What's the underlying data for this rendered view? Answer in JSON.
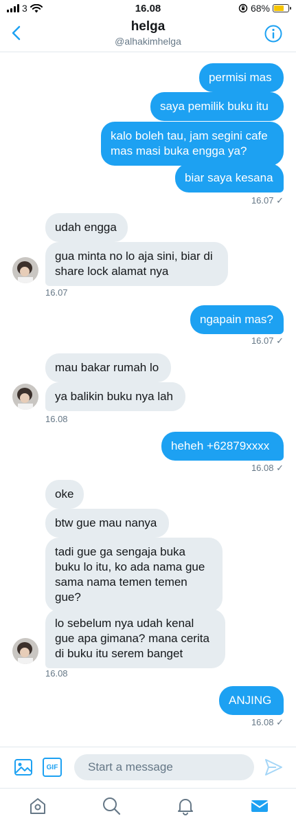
{
  "status_bar": {
    "carrier": "3",
    "time": "16.08",
    "battery": "68%",
    "battery_level": 0.68
  },
  "header": {
    "title": "helga",
    "handle": "@alhakimhelga"
  },
  "colors": {
    "accent": "#1da1f2",
    "incoming_bubble": "#e6ecf0",
    "meta_text": "#657786"
  },
  "messages": [
    {
      "dir": "out",
      "text": "permisi mas"
    },
    {
      "dir": "out",
      "text": "saya pemilik buku itu"
    },
    {
      "dir": "out",
      "text": "kalo boleh tau, jam segini cafe\nmas masi buka engga ya?"
    },
    {
      "dir": "out",
      "text": "biar saya kesana"
    },
    {
      "dir": "in",
      "text": "udah engga"
    },
    {
      "dir": "in",
      "text": "gua minta no lo aja sini, biar di\nshare lock alamat nya"
    },
    {
      "dir": "out",
      "text": "ngapain mas?"
    },
    {
      "dir": "in",
      "text": "mau bakar rumah lo"
    },
    {
      "dir": "in",
      "text": "ya balikin buku nya lah"
    },
    {
      "dir": "out",
      "text": "heheh +62879xxxx"
    },
    {
      "dir": "in",
      "text": "oke"
    },
    {
      "dir": "in",
      "text": "btw gue mau nanya"
    },
    {
      "dir": "in",
      "text": "tadi gue ga sengaja buka\nbuku lo itu, ko ada nama gue\nsama nama temen temen\ngue?"
    },
    {
      "dir": "in",
      "text": "lo sebelum nya udah kenal\ngue apa gimana? mana cerita\ndi buku itu serem banget"
    },
    {
      "dir": "out",
      "text": "ANJING"
    }
  ],
  "timestamps": [
    {
      "dir": "out",
      "text": "16.07 ✓"
    },
    {
      "dir": "in",
      "text": "16.07"
    },
    {
      "dir": "out",
      "text": "16.07 ✓"
    },
    {
      "dir": "in",
      "text": "16.08"
    },
    {
      "dir": "out",
      "text": "16.08 ✓"
    },
    {
      "dir": "in",
      "text": "16.08"
    },
    {
      "dir": "out",
      "text": "16.08 ✓"
    }
  ],
  "composer": {
    "placeholder": "Start a message",
    "image_icon": "image-icon",
    "gif_label": "GIF",
    "send_icon": "send-icon"
  },
  "tabbar": [
    {
      "name": "home-icon"
    },
    {
      "name": "search-icon"
    },
    {
      "name": "bell-icon"
    },
    {
      "name": "mail-icon",
      "active": true
    }
  ]
}
